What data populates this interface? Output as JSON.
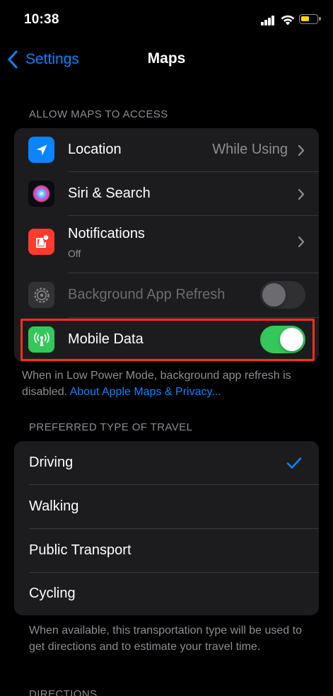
{
  "status_bar": {
    "time": "10:38"
  },
  "nav": {
    "back_label": "Settings",
    "title": "Maps"
  },
  "allow_access": {
    "header": "ALLOW MAPS TO ACCESS",
    "rows": [
      {
        "label": "Location",
        "value": "While Using",
        "icon": "location-arrow-icon",
        "color": "#0a84ff"
      },
      {
        "label": "Siri & Search",
        "icon": "siri-icon"
      },
      {
        "label": "Notifications",
        "sublabel": "Off",
        "icon": "notifications-icon",
        "color": "#ff3b30"
      },
      {
        "label": "Background App Refresh",
        "icon": "gear-icon",
        "color": "#636366",
        "toggle": false
      },
      {
        "label": "Mobile Data",
        "icon": "antenna-icon",
        "color": "#34c759",
        "toggle": true
      }
    ],
    "footer": "When in Low Power Mode, background app refresh is disabled.",
    "footer_link": "About Apple Maps & Privacy..."
  },
  "travel": {
    "header": "PREFERRED TYPE OF TRAVEL",
    "options": [
      "Driving",
      "Walking",
      "Public Transport",
      "Cycling"
    ],
    "selected": "Driving",
    "footer": "When available, this transportation type will be used to get directions and to estimate your travel time."
  },
  "directions": {
    "header": "DIRECTIONS"
  },
  "colors": {
    "accent": "#0a84ff",
    "toggle_on": "#34c759",
    "highlight": "#ff2d20"
  }
}
